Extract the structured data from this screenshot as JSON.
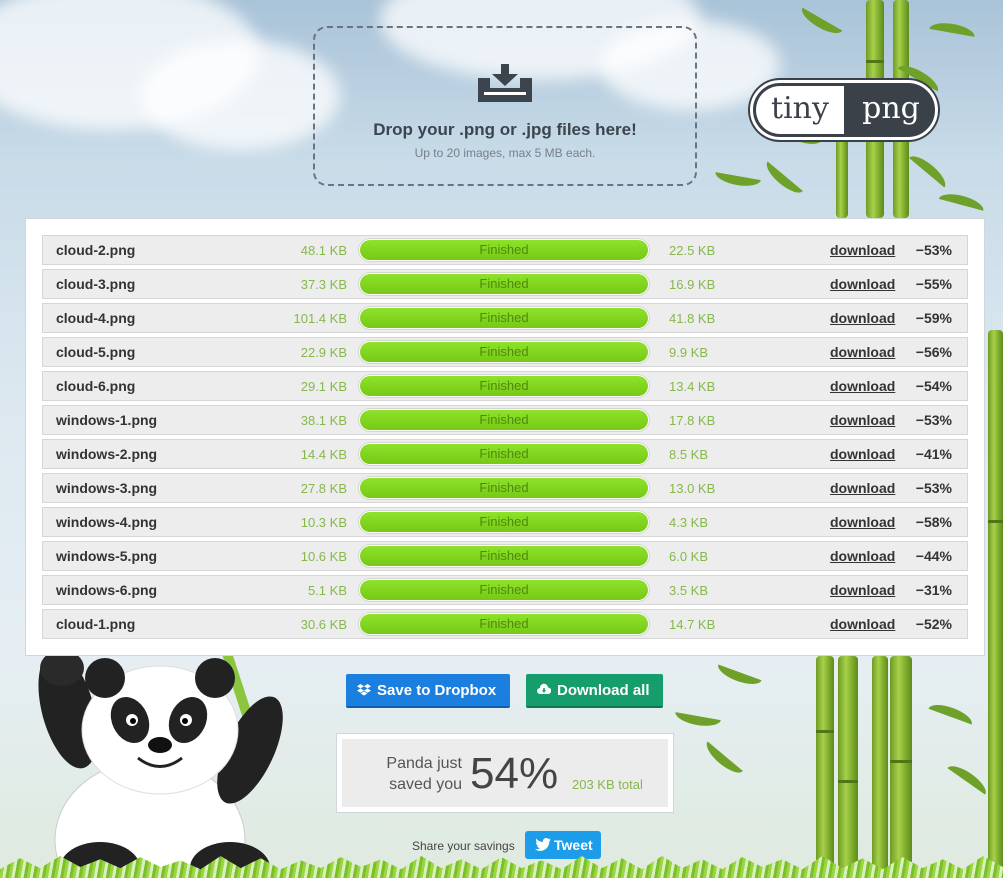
{
  "dropzone": {
    "title": "Drop your .png or .jpg files here!",
    "subtitle": "Up to 20 images, max 5 MB each.",
    "icon": "download-tray-icon"
  },
  "logo": {
    "tiny": "tiny",
    "png": "png"
  },
  "files": [
    {
      "name": "cloud-2.png",
      "original": "48.1 KB",
      "status": "Finished",
      "compressed": "22.5 KB",
      "action": "download",
      "saving": "−53%",
      "progress": 1.0
    },
    {
      "name": "cloud-3.png",
      "original": "37.3 KB",
      "status": "Finished",
      "compressed": "16.9 KB",
      "action": "download",
      "saving": "−55%",
      "progress": 1.0
    },
    {
      "name": "cloud-4.png",
      "original": "101.4 KB",
      "status": "Finished",
      "compressed": "41.8 KB",
      "action": "download",
      "saving": "−59%",
      "progress": 1.0
    },
    {
      "name": "cloud-5.png",
      "original": "22.9 KB",
      "status": "Finished",
      "compressed": "9.9 KB",
      "action": "download",
      "saving": "−56%",
      "progress": 1.0
    },
    {
      "name": "cloud-6.png",
      "original": "29.1 KB",
      "status": "Finished",
      "compressed": "13.4 KB",
      "action": "download",
      "saving": "−54%",
      "progress": 1.0
    },
    {
      "name": "windows-1.png",
      "original": "38.1 KB",
      "status": "Finished",
      "compressed": "17.8 KB",
      "action": "download",
      "saving": "−53%",
      "progress": 1.0
    },
    {
      "name": "windows-2.png",
      "original": "14.4 KB",
      "status": "Finished",
      "compressed": "8.5 KB",
      "action": "download",
      "saving": "−41%",
      "progress": 1.0
    },
    {
      "name": "windows-3.png",
      "original": "27.8 KB",
      "status": "Finished",
      "compressed": "13.0 KB",
      "action": "download",
      "saving": "−53%",
      "progress": 1.0
    },
    {
      "name": "windows-4.png",
      "original": "10.3 KB",
      "status": "Finished",
      "compressed": "4.3 KB",
      "action": "download",
      "saving": "−58%",
      "progress": 1.0
    },
    {
      "name": "windows-5.png",
      "original": "10.6 KB",
      "status": "Finished",
      "compressed": "6.0 KB",
      "action": "download",
      "saving": "−44%",
      "progress": 1.0
    },
    {
      "name": "windows-6.png",
      "original": "5.1 KB",
      "status": "Finished",
      "compressed": "3.5 KB",
      "action": "download",
      "saving": "−31%",
      "progress": 1.0
    },
    {
      "name": "cloud-1.png",
      "original": "30.6 KB",
      "status": "Finished",
      "compressed": "14.7 KB",
      "action": "download",
      "saving": "−52%",
      "progress": 1.0
    }
  ],
  "actions": {
    "dropbox_label": "Save to Dropbox",
    "dropbox_icon": "dropbox-icon",
    "download_all_label": "Download all",
    "download_all_icon": "cloud-download-icon"
  },
  "savings": {
    "label": "Panda just saved you",
    "percent": "54%",
    "total": "203 KB total"
  },
  "share": {
    "label": "Share your savings",
    "tweet_label": "Tweet",
    "tweet_icon": "twitter-bird-icon"
  },
  "colors": {
    "progress": "#7fd21c",
    "size_text": "#86b84b",
    "dropbox": "#1b7fe0",
    "download_all": "#159e6c",
    "tweet": "#1d9cea"
  }
}
